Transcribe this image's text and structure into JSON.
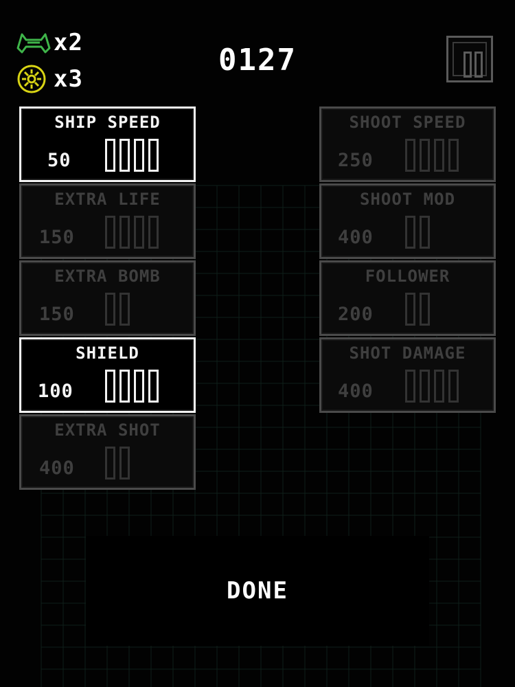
{
  "hud": {
    "lives": {
      "icon": "ship-icon",
      "count": "x2",
      "color": "#3fb54a"
    },
    "bombs": {
      "icon": "bomb-icon",
      "count": "x3",
      "color": "#d8d414"
    },
    "score": "0127",
    "pause_icon": "pause-icon"
  },
  "upgrades": {
    "left": [
      {
        "label": "SHIP SPEED",
        "cost": "50",
        "slots": 4,
        "selected": true
      },
      {
        "label": "EXTRA LIFE",
        "cost": "150",
        "slots": 4,
        "selected": false
      },
      {
        "label": "EXTRA BOMB",
        "cost": "150",
        "slots": 2,
        "selected": false
      },
      {
        "label": "SHIELD",
        "cost": "100",
        "slots": 4,
        "selected": true
      },
      {
        "label": "EXTRA SHOT",
        "cost": "400",
        "slots": 2,
        "selected": false
      }
    ],
    "right": [
      {
        "label": "SHOOT SPEED",
        "cost": "250",
        "slots": 4,
        "selected": false
      },
      {
        "label": "SHOOT MOD",
        "cost": "400",
        "slots": 2,
        "selected": false
      },
      {
        "label": "FOLLOWER",
        "cost": "200",
        "slots": 2,
        "selected": false
      },
      {
        "label": "SHOT DAMAGE",
        "cost": "400",
        "slots": 4,
        "selected": false
      }
    ]
  },
  "done_label": "DONE",
  "colors": {
    "background": "#020202",
    "grid": "#0f1f19",
    "card_border": "#4a4a4a",
    "card_border_selected": "#f2f2f2",
    "text_dim": "#3f3f3f",
    "text_bright": "#f4f4f4"
  }
}
